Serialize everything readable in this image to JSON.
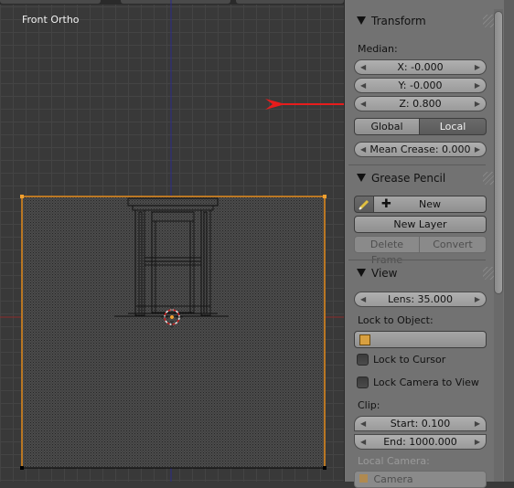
{
  "viewport": {
    "view_name": "Front Ortho"
  },
  "transform": {
    "header": "Transform",
    "median_label": "Median:",
    "x_field": "X: -0.000",
    "y_field": "Y: -0.000",
    "z_field": "Z: 0.800",
    "global_label": "Global",
    "local_label": "Local",
    "mean_crease_field": "Mean Crease: 0.000"
  },
  "grease_pencil": {
    "header": "Grease Pencil",
    "new_label": "New",
    "new_layer_label": "New Layer",
    "delete_frame_label": "Delete Frame",
    "convert_label": "Convert"
  },
  "view": {
    "header": "View",
    "lens_field": "Lens: 35.000",
    "lock_to_object_label": "Lock to Object:",
    "lock_to_cursor_label": "Lock to Cursor",
    "lock_camera_label": "Lock Camera to View",
    "clip_label": "Clip:",
    "clip_start_field": "Start: 0.100",
    "clip_end_field": "End: 1000.000",
    "local_camera_label": "Local Camera:",
    "camera_field": "Camera"
  },
  "colors": {
    "selection_outline": "#e38a1a",
    "annotation_arrow": "#e81c1c",
    "x_axis": "#8c2a2a",
    "z_axis": "#2b2b8c"
  }
}
